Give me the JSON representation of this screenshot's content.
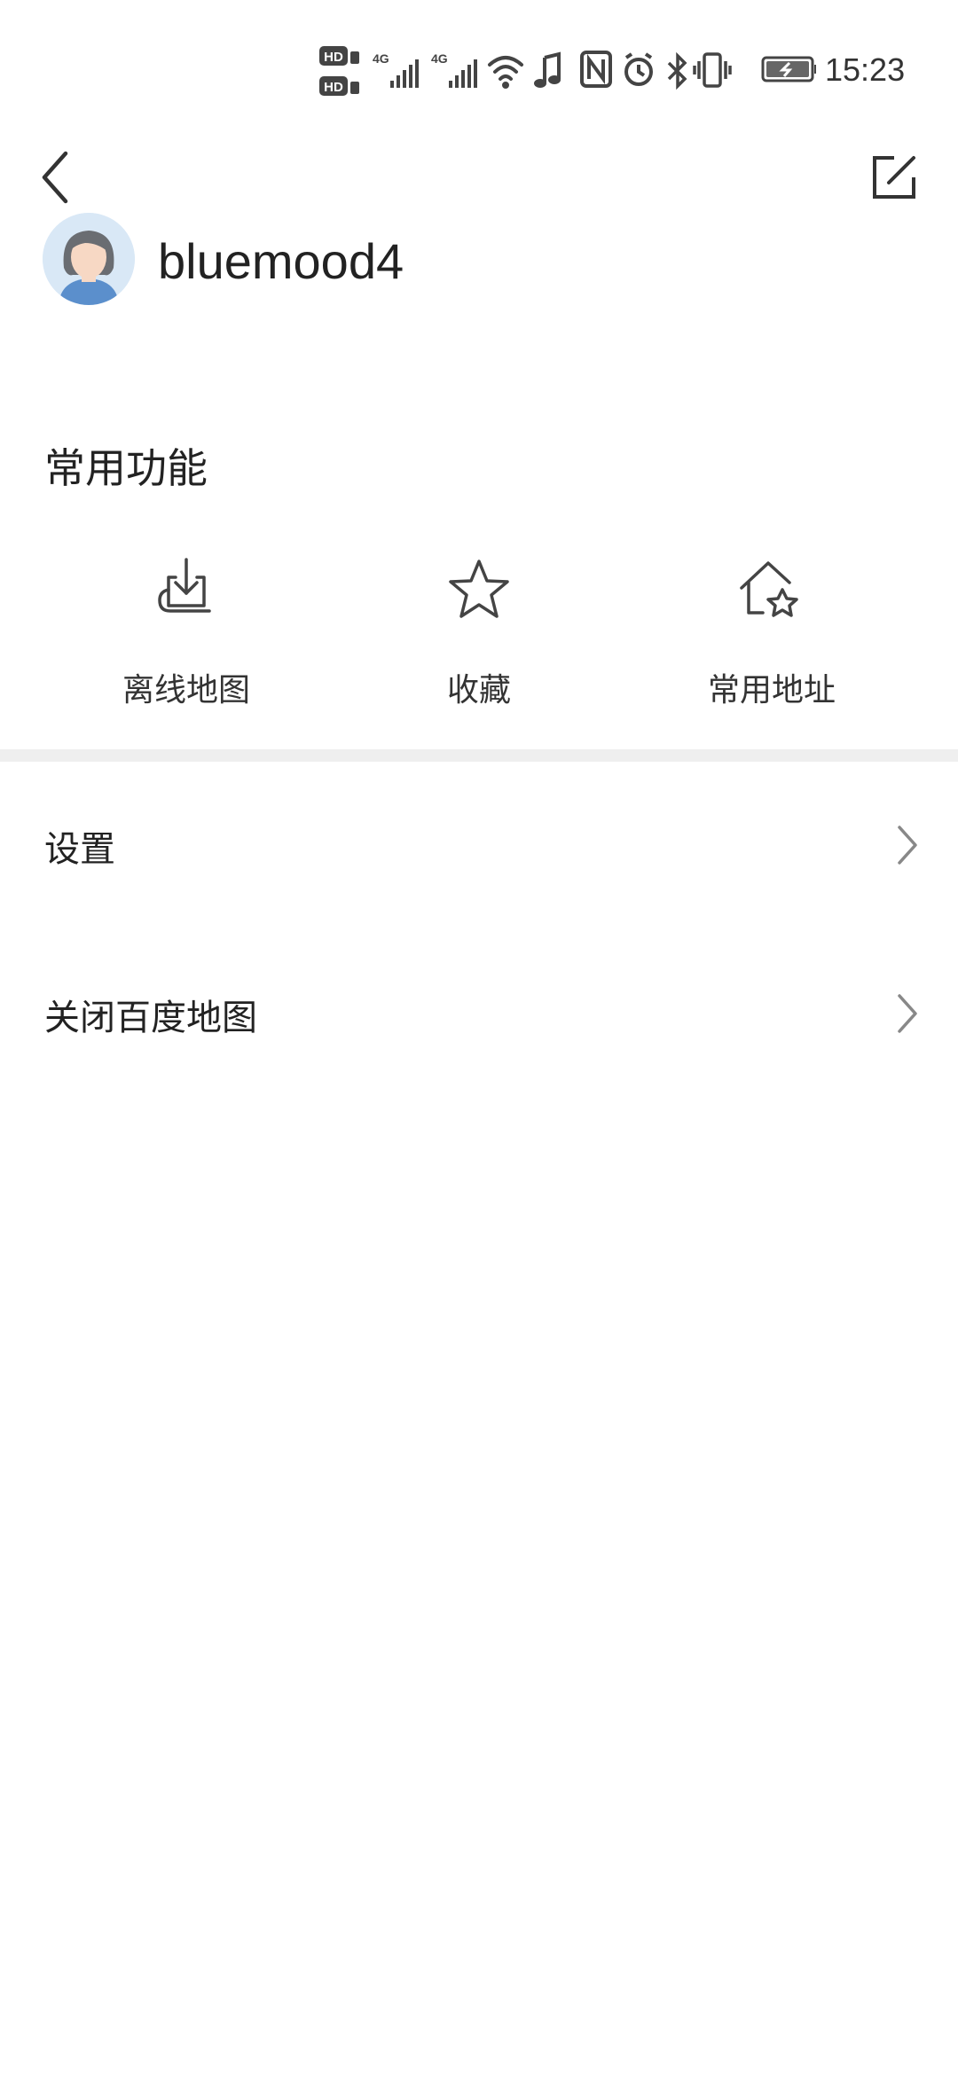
{
  "status_bar": {
    "time": "15:23",
    "icons": [
      "hd-sim1-icon",
      "hd-sim2-icon",
      "signal-4g-1-icon",
      "signal-4g-2-icon",
      "wifi-icon",
      "music-icon",
      "nfc-icon",
      "alarm-icon",
      "bluetooth-icon",
      "vibrate-icon",
      "battery-icon"
    ]
  },
  "header": {
    "username": "bluemood4",
    "icons": [
      "back-icon",
      "edit-icon",
      "avatar"
    ]
  },
  "common_functions": {
    "title": "常用功能",
    "items": [
      {
        "label": "离线地图",
        "icon": "offline-map-download-icon"
      },
      {
        "label": "收藏",
        "icon": "star-icon"
      },
      {
        "label": "常用地址",
        "icon": "home-star-icon"
      }
    ]
  },
  "menu": [
    {
      "label": "设置",
      "icon": "chevron-right-icon"
    },
    {
      "label": "关闭百度地图",
      "icon": "chevron-right-icon"
    }
  ],
  "colors": {
    "background": "#ffffff",
    "divider": "#efefef",
    "text": "#222222",
    "icon": "#444444",
    "avatar_bg": "#d9e8f6"
  }
}
